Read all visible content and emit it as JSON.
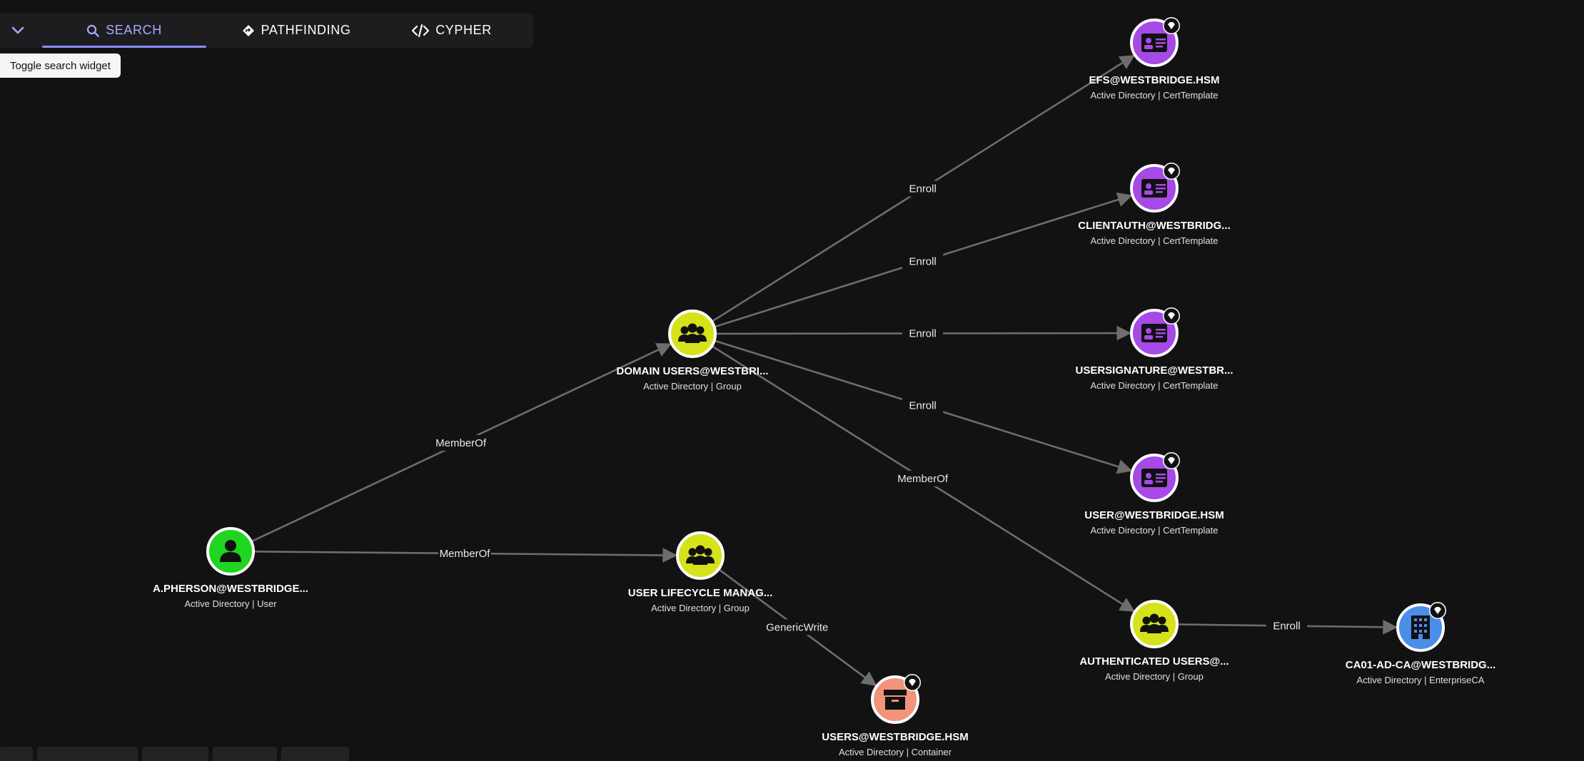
{
  "search_widget": {
    "tabs": [
      {
        "label": "SEARCH",
        "icon": "search-icon",
        "active": true
      },
      {
        "label": "PATHFINDING",
        "icon": "diamond-directions-icon",
        "active": false
      },
      {
        "label": "CYPHER",
        "icon": "code-icon",
        "active": false
      }
    ],
    "toggle_tooltip": "Toggle search widget"
  },
  "colors": {
    "user": "#1fd51f",
    "group": "#d6e21a",
    "cert_template": "#a649e6",
    "container": "#f2947a",
    "enterprise_ca": "#4a8ee8",
    "edge": "#6d6d6d",
    "accent": "#8c8cff"
  },
  "graph": {
    "nodes": [
      {
        "id": "user",
        "name": "A.PHERSON@WESTBRIDGE...",
        "subtitle": "Active Directory | User",
        "type": "user",
        "tier_zero": false
      },
      {
        "id": "domain_users",
        "name": "DOMAIN USERS@WESTBRI...",
        "subtitle": "Active Directory | Group",
        "type": "group",
        "tier_zero": false
      },
      {
        "id": "ulm",
        "name": "USER LIFECYCLE MANAG...",
        "subtitle": "Active Directory | Group",
        "type": "group",
        "tier_zero": false
      },
      {
        "id": "efs",
        "name": "EFS@WESTBRIDGE.HSM",
        "subtitle": "Active Directory | CertTemplate",
        "type": "cert_template",
        "tier_zero": true
      },
      {
        "id": "clientauth",
        "name": "CLIENTAUTH@WESTBRIDG...",
        "subtitle": "Active Directory | CertTemplate",
        "type": "cert_template",
        "tier_zero": true
      },
      {
        "id": "usersig",
        "name": "USERSIGNATURE@WESTBR...",
        "subtitle": "Active Directory | CertTemplate",
        "type": "cert_template",
        "tier_zero": true
      },
      {
        "id": "usertpl",
        "name": "USER@WESTBRIDGE.HSM",
        "subtitle": "Active Directory | CertTemplate",
        "type": "cert_template",
        "tier_zero": true
      },
      {
        "id": "authusers",
        "name": "AUTHENTICATED USERS@...",
        "subtitle": "Active Directory | Group",
        "type": "group",
        "tier_zero": false
      },
      {
        "id": "ca",
        "name": "CA01-AD-CA@WESTBRIDG...",
        "subtitle": "Active Directory | EnterpriseCA",
        "type": "enterprise_ca",
        "tier_zero": true
      },
      {
        "id": "users_container",
        "name": "USERS@WESTBRIDGE.HSM",
        "subtitle": "Active Directory | Container",
        "type": "container",
        "tier_zero": true
      }
    ],
    "edges": [
      {
        "from": "user",
        "to": "domain_users",
        "label": "MemberOf"
      },
      {
        "from": "user",
        "to": "ulm",
        "label": "MemberOf"
      },
      {
        "from": "domain_users",
        "to": "efs",
        "label": "Enroll"
      },
      {
        "from": "domain_users",
        "to": "clientauth",
        "label": "Enroll"
      },
      {
        "from": "domain_users",
        "to": "usersig",
        "label": "Enroll"
      },
      {
        "from": "domain_users",
        "to": "usertpl",
        "label": "Enroll"
      },
      {
        "from": "domain_users",
        "to": "authusers",
        "label": "MemberOf"
      },
      {
        "from": "authusers",
        "to": "ca",
        "label": "Enroll"
      },
      {
        "from": "ulm",
        "to": "users_container",
        "label": "GenericWrite"
      }
    ]
  }
}
